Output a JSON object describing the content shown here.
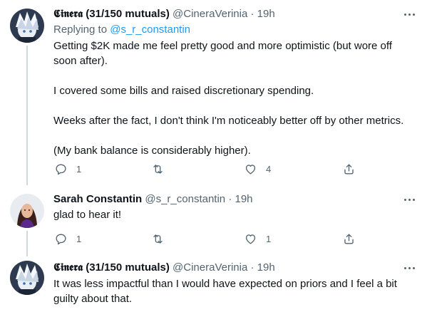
{
  "tweets": [
    {
      "display_name": "𝕮𝖎𝖓𝖊𝖗𝖆 (31/150 mutuals)",
      "handle": "@CineraVerinia",
      "time": "· 19h",
      "reply_prefix": "Replying to ",
      "reply_handle": "@s_r_constantin",
      "paragraphs": [
        "Getting $2K made me feel pretty good and more optimistic (but wore off soon after).",
        "I covered some bills and raised discretionary spending.",
        "Weeks after the fact, I don't think I'm noticeably better off by other metrics.",
        "(My bank balance is considerably higher)."
      ],
      "reply_count": "1",
      "retweet_count": "",
      "like_count": "4"
    },
    {
      "display_name": "Sarah Constantin",
      "handle": "@s_r_constantin",
      "time": "· 19h",
      "paragraphs": [
        "glad to hear it!"
      ],
      "reply_count": "1",
      "retweet_count": "",
      "like_count": "1"
    },
    {
      "display_name": "𝕮𝖎𝖓𝖊𝖗𝖆 (31/150 mutuals)",
      "handle": "@CineraVerinia",
      "time": "· 19h",
      "paragraphs": [
        "It was less impactful than I would have expected on priors and I feel a bit guilty about that."
      ]
    }
  ],
  "icons": {
    "reply": "reply-icon",
    "retweet": "retweet-icon",
    "like": "heart-icon",
    "share": "share-icon",
    "more": "more-options-icon"
  },
  "colors": {
    "text": "#0f1419",
    "secondary": "#536471",
    "link": "#1d9bf0",
    "thread_line": "#cfd9de"
  }
}
